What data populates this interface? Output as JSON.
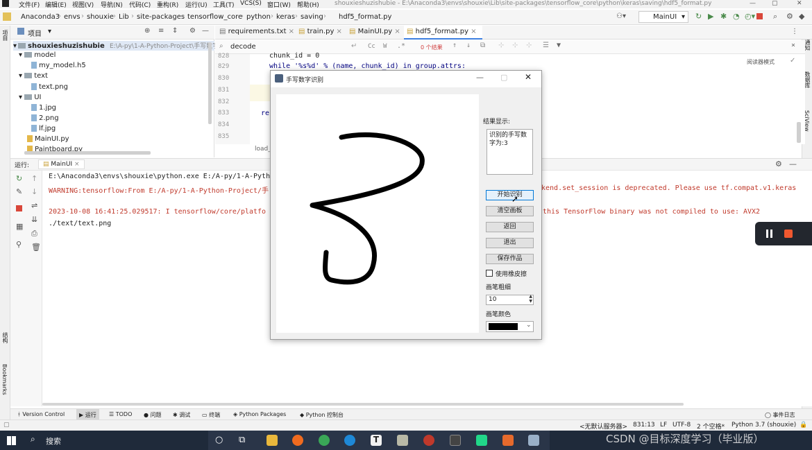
{
  "menubar": {
    "items": [
      "文件(F)",
      "编辑(E)",
      "视图(V)",
      "导航(N)",
      "代码(C)",
      "重构(R)",
      "运行(U)",
      "工具(T)",
      "VCS(S)",
      "窗口(W)",
      "帮助(H)"
    ],
    "window_title": "shouxieshuzishubie - E:\\Anaconda3\\envs\\shouxie\\Lib\\site-packages\\tensorflow_core\\python\\keras\\saving\\hdf5_format.py"
  },
  "breadcrumb": [
    "Anaconda3",
    "envs",
    "shouxie",
    "Lib",
    "site-packages",
    "tensorflow_core",
    "python",
    "keras",
    "saving",
    "hdf5_format.py"
  ],
  "run_config": "MainUI",
  "project": {
    "header": "项目",
    "root": "shouxieshuzishubie",
    "root_path": "E:\\A-py\\1-A-Python-Project\\手写数字...",
    "items": [
      {
        "label": "model",
        "kind": "folder",
        "depth": 1
      },
      {
        "label": "my_model.h5",
        "kind": "file",
        "depth": 2
      },
      {
        "label": "text",
        "kind": "folder",
        "depth": 1
      },
      {
        "label": "text.png",
        "kind": "file",
        "depth": 2
      },
      {
        "label": "UI",
        "kind": "folder",
        "depth": 1
      },
      {
        "label": "1.jpg",
        "kind": "file",
        "depth": 2
      },
      {
        "label": "2.png",
        "kind": "file",
        "depth": 2
      },
      {
        "label": "lf.jpg",
        "kind": "file",
        "depth": 2
      },
      {
        "label": "MainUI.py",
        "kind": "file",
        "depth": 1
      },
      {
        "label": "Paintboard.py",
        "kind": "file",
        "depth": 1
      }
    ]
  },
  "tabs": [
    "requirements.txt",
    "train.py",
    "MainUI.py",
    "hdf5_format.py"
  ],
  "search": {
    "query": "decode",
    "result": "0 个结果",
    "cc": "Cc",
    "w": "W"
  },
  "editor": {
    "reader_mode": "阅读器模式",
    "lines": [
      {
        "n": "828",
        "code": "chunk_id = 0"
      },
      {
        "n": "829",
        "code": "while '%s%d' % (name, chunk_id) in group.attrs:"
      },
      {
        "n": "830",
        "code": ""
      },
      {
        "n": "831",
        "code": ""
      },
      {
        "n": "832",
        "code": ""
      },
      {
        "n": "833",
        "code": "re"
      },
      {
        "n": "834",
        "code": ""
      },
      {
        "n": "835",
        "code": ""
      }
    ],
    "footer_fn": "load_"
  },
  "run": {
    "label": "运行:",
    "tab": "MainUI",
    "lines": [
      "E:\\Anaconda3\\envs\\shouxie\\python.exe E:/A-py/1-A-Pyth",
      "WARNING:tensorflow:From E:/A-py/1-A-Python-Project/手",
      "",
      "2023-10-08 16:41:25.029517: I tensorflow/core/platfo",
      "./text/text.png"
    ],
    "right_lines": [
      "kend.set_session is deprecated. Please use tf.compat.v1.keras",
      "this TensorFlow binary was not compiled to use: AVX2"
    ]
  },
  "bottom_tools": [
    "Version Control",
    "运行",
    "TODO",
    "问题",
    "调试",
    "终端",
    "Python Packages",
    "Python 控制台",
    "事件日志"
  ],
  "status": [
    "<无默认服务器>",
    "831:13",
    "LF",
    "UTF-8",
    "2 个空格*",
    "Python 3.7 (shouxie)"
  ],
  "taskbar": {
    "search": "搜索",
    "watermark": "CSDN @目标深度学习（毕业版）"
  },
  "dialog": {
    "title": "手写数字识别",
    "result_label": "结果显示:",
    "result_text": "识别的手写数字为:3",
    "buttons": [
      "开始识别",
      "清空画板",
      "返回",
      "退出",
      "保存作品"
    ],
    "eraser_label": "使用橡皮擦",
    "pen_size_label": "画笔粗细",
    "pen_size": "10",
    "pen_color_label": "画笔颜色",
    "pen_color": "#000000"
  },
  "side_labels": {
    "left_top": "项目",
    "left_structure": "结构",
    "left_bookmarks": "Bookmarks",
    "right_1": "通知",
    "right_2": "数据库",
    "right_3": "SciView"
  }
}
